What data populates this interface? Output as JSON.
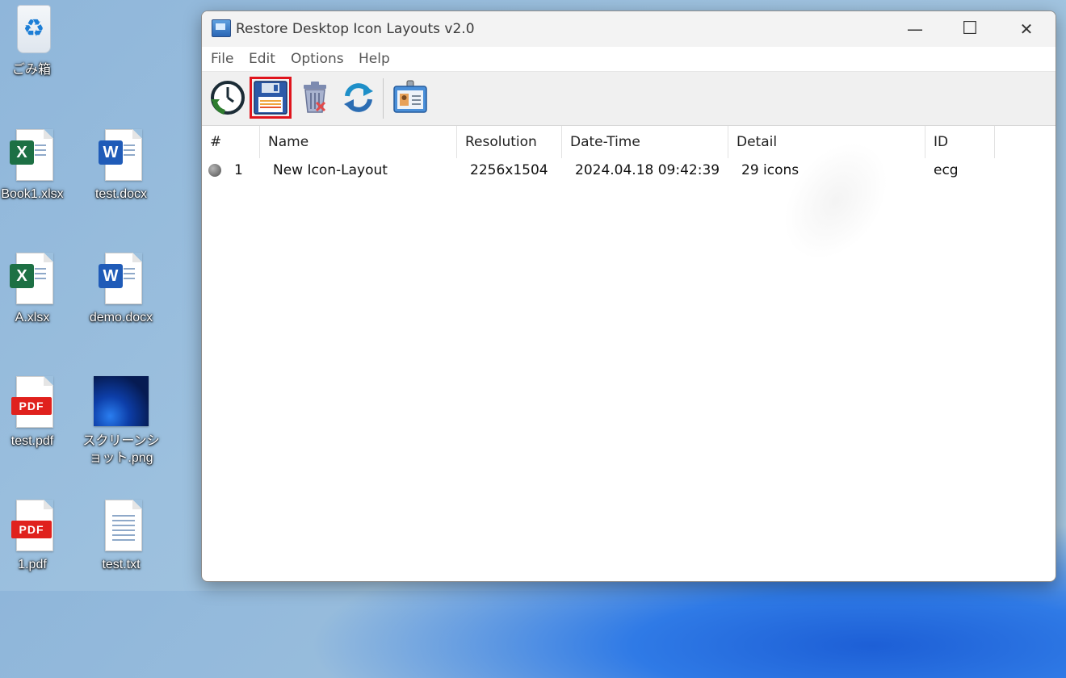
{
  "desktop": {
    "icons": [
      {
        "label": "ごみ箱"
      },
      {
        "label": "Book1.xlsx"
      },
      {
        "label": "test.docx"
      },
      {
        "label": "A.xlsx"
      },
      {
        "label": "demo.docx"
      },
      {
        "label": "test.pdf"
      },
      {
        "label": "スクリーンショット.png"
      },
      {
        "label": "1.pdf"
      },
      {
        "label": "test.txt"
      }
    ],
    "badges": {
      "excel": "X",
      "word": "W",
      "pdf": "PDF",
      "recycle": "♻"
    }
  },
  "window": {
    "title": "Restore Desktop Icon Layouts v2.0",
    "controls": {
      "minimize": "—",
      "maximize": "☐",
      "close": "✕"
    },
    "menu": [
      "File",
      "Edit",
      "Options",
      "Help"
    ],
    "toolbar": [
      {
        "icon": "restore-clock-icon"
      },
      {
        "icon": "save-floppy-icon",
        "highlighted": true,
        "highlight_color": "#e0141c"
      },
      {
        "icon": "delete-trash-icon"
      },
      {
        "icon": "refresh-icon"
      },
      {
        "icon": "id-card-icon"
      }
    ],
    "list": {
      "columns": [
        "#",
        "Name",
        "Resolution",
        "Date-Time",
        "Detail",
        "ID"
      ],
      "rows": [
        {
          "num": "1",
          "name": "New Icon-Layout",
          "resolution": "2256x1504",
          "datetime": "2024.04.18 09:42:39",
          "detail": "29 icons",
          "id": "ecg"
        }
      ]
    }
  }
}
